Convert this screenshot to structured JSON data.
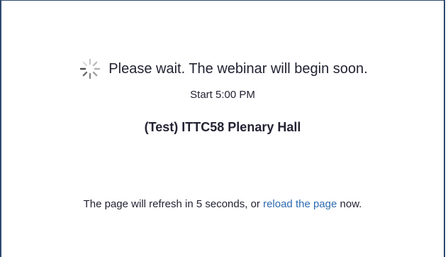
{
  "waiting": {
    "icon": "loading-spinner-icon",
    "message": "Please wait. The webinar will begin soon."
  },
  "start": {
    "label": "Start 5:00 PM"
  },
  "webinar": {
    "title": "(Test) ITTC58 Plenary Hall"
  },
  "refresh": {
    "prefix": "The page will refresh in 5 seconds, or",
    "link_label": "reload the page",
    "suffix": "now."
  },
  "colors": {
    "text": "#232333",
    "link": "#2d6ab0",
    "border": "#2d4a6d"
  }
}
